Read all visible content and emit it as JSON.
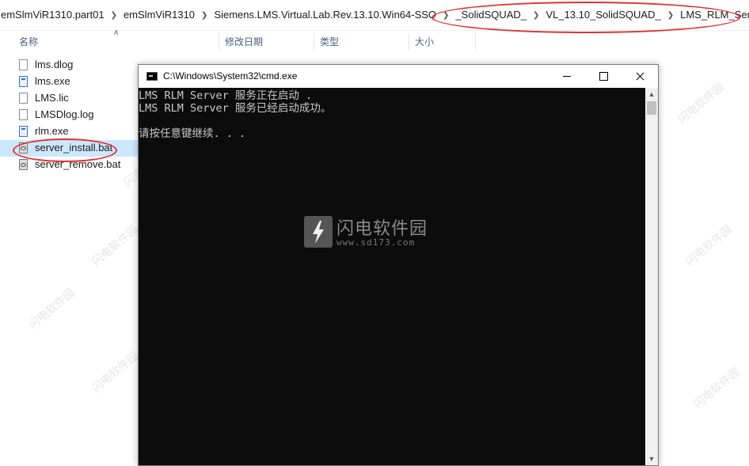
{
  "breadcrumb": [
    "emSlmViR1310.part01",
    "emSlmViR1310",
    "Siemens.LMS.Virtual.Lab.Rev.13.10.Win64-SSQ",
    "_SolidSQUAD_",
    "VL_13.10_SolidSQUAD_",
    "LMS_RLM_Server"
  ],
  "columns": {
    "name": "名称",
    "modified": "修改日期",
    "type": "类型",
    "size": "大小"
  },
  "files": [
    {
      "name": "lms.dlog",
      "icon": "document-icon"
    },
    {
      "name": "lms.exe",
      "icon": "exe-icon"
    },
    {
      "name": "LMS.lic",
      "icon": "document-icon"
    },
    {
      "name": "LMSDlog.log",
      "icon": "document-icon"
    },
    {
      "name": "rlm.exe",
      "icon": "exe-icon"
    },
    {
      "name": "server_install.bat",
      "icon": "bat-icon",
      "selected": true
    },
    {
      "name": "server_remove.bat",
      "icon": "bat-icon"
    }
  ],
  "cmd": {
    "title": "C:\\Windows\\System32\\cmd.exe",
    "lines": [
      "LMS RLM Server 服务正在启动 .",
      "LMS RLM Server 服务已经启动成功。",
      "",
      "请按任意键继续. . ."
    ]
  },
  "watermark": {
    "logo_text": "闪电软件园",
    "url": "www.sd173.com",
    "repeat_text": "闪电软件园"
  },
  "colors": {
    "console_bg": "#0c0c0c",
    "console_fg": "#c8c8c8",
    "annotation": "#e53030",
    "selection": "#cce8ff"
  }
}
